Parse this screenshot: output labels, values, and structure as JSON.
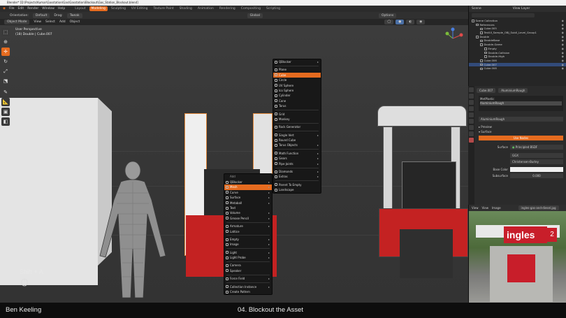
{
  "window": {
    "title": "Blender* [D:\\Projects\\Kumar\\Gasstation\\Gas\\Gasstation\\Blockout\\Gas_Station_Blockout.blend]"
  },
  "menubar": {
    "items": [
      "File",
      "Edit",
      "Render",
      "Window",
      "Help"
    ],
    "workspaces": [
      "Layout",
      "Modeling",
      "Sculpting",
      "UV Editing",
      "Texture Paint",
      "Shading",
      "Animation",
      "Rendering",
      "Compositing",
      "Scripting"
    ],
    "active_workspace": "Modeling",
    "scene_label": "Scene",
    "viewlayer_label": "View Layer"
  },
  "tool_options": {
    "orientation_label": "Orientation:",
    "orientation_value": "Default",
    "drag_label": "Drag:",
    "drag_value": "Tweak",
    "transform_orientation": "Global",
    "options_label": "Options"
  },
  "header": {
    "mode": "Object Mode",
    "items": [
      "View",
      "Select",
      "Add",
      "Object"
    ]
  },
  "viewport": {
    "perspective": "User Perspective",
    "object_info": "(18) Double | Cube.007",
    "shortcut_overlay": "Shift + A"
  },
  "toolbar": {
    "tools": [
      "select-icon",
      "cursor-icon",
      "move-icon",
      "rotate-icon",
      "scale-icon",
      "transform-icon",
      "annotate-icon",
      "measure-icon",
      "add-cube-icon",
      "extrude-icon"
    ]
  },
  "add_menu": {
    "title": "Add",
    "items": [
      {
        "label": "QBlocker",
        "submenu": true
      },
      {
        "label": "Mesh",
        "submenu": true,
        "highlight": true
      },
      {
        "label": "Curve",
        "submenu": true
      },
      {
        "label": "Surface",
        "submenu": true
      },
      {
        "label": "Metaball",
        "submenu": true
      },
      {
        "label": "Text",
        "submenu": false
      },
      {
        "label": "Volume",
        "submenu": true
      },
      {
        "label": "Grease Pencil",
        "submenu": true
      },
      {
        "label": "Armature",
        "submenu": true
      },
      {
        "label": "Lattice",
        "submenu": false
      },
      {
        "label": "Empty",
        "submenu": true
      },
      {
        "label": "Image",
        "submenu": true
      },
      {
        "label": "Light",
        "submenu": true
      },
      {
        "label": "Light Probe",
        "submenu": true
      },
      {
        "label": "Camera",
        "submenu": false
      },
      {
        "label": "Speaker",
        "submenu": false
      },
      {
        "label": "Force Field",
        "submenu": true
      },
      {
        "label": "Collection Instance",
        "submenu": true
      },
      {
        "label": "Create Pattern",
        "submenu": false
      }
    ]
  },
  "mesh_menu": {
    "items": [
      {
        "label": "QBlocker",
        "submenu": true
      },
      {
        "label": "Plane"
      },
      {
        "label": "Cube",
        "highlight": true
      },
      {
        "label": "Circle"
      },
      {
        "label": "UV Sphere"
      },
      {
        "label": "Ico Sphere"
      },
      {
        "label": "Cylinder"
      },
      {
        "label": "Cone"
      },
      {
        "label": "Torus"
      },
      {
        "label": "Grid"
      },
      {
        "label": "Monkey"
      },
      {
        "label": "Rock Generator"
      },
      {
        "label": "Single Vert",
        "submenu": true
      },
      {
        "label": "Round Cube"
      },
      {
        "label": "Torus Objects",
        "submenu": true
      },
      {
        "label": "Math Function",
        "submenu": true
      },
      {
        "label": "Gears",
        "submenu": true
      },
      {
        "label": "Pipe Joints",
        "submenu": true
      },
      {
        "label": "Diamonds",
        "submenu": true
      },
      {
        "label": "Extras",
        "submenu": true
      },
      {
        "label": "Parent To Empty"
      },
      {
        "label": "Landscape"
      }
    ]
  },
  "outliner": {
    "title": "Scene Collection",
    "rows": [
      {
        "label": "Scene Collection",
        "indent": 0,
        "selected": false
      },
      {
        "label": "References",
        "indent": 1,
        "selected": false
      },
      {
        "label": "Cube.005",
        "indent": 2,
        "selected": false
      },
      {
        "label": "TestUI_Sample_OBJ_Sub0_Level_Group1",
        "indent": 2,
        "selected": false
      },
      {
        "label": "Double",
        "indent": 1,
        "selected": false
      },
      {
        "label": "DoubleBase",
        "indent": 2,
        "selected": false
      },
      {
        "label": "Double-Game",
        "indent": 2,
        "selected": false
      },
      {
        "label": "Empty",
        "indent": 3,
        "selected": false
      },
      {
        "label": "Double-Collision",
        "indent": 3,
        "selected": false
      },
      {
        "label": "Double-High",
        "indent": 3,
        "selected": false
      },
      {
        "label": "Cube.006",
        "indent": 2,
        "selected": false
      },
      {
        "label": "Cube.007",
        "indent": 2,
        "selected": true
      },
      {
        "label": "Cube.008",
        "indent": 2,
        "selected": false
      }
    ]
  },
  "properties": {
    "object_name": "Cube.007",
    "material_name": "AluminiumRough",
    "slots": [
      "MetPlastic",
      "AluminiumRough"
    ],
    "material_field": "AluminiumRough",
    "sections": [
      "Preview",
      "Surface"
    ],
    "use_nodes_label": "Use Nodes",
    "surface_label": "Surface",
    "surface_value": "Principled BSDF",
    "distribution": "GGX",
    "subsurface_method": "Christensen-Burley",
    "base_color_label": "Base Color",
    "subsurface_label": "Subsurface",
    "subsurface_value": "0.000"
  },
  "image_editor": {
    "items": [
      "View",
      "View",
      "Image"
    ],
    "image_name": "ingles-gas-and-diesel.jpg",
    "sign_text": "ingles",
    "sign_number": "2"
  },
  "caption": {
    "author": "Ben Keeling",
    "lesson": "04. Blockout the Asset"
  },
  "colors": {
    "accent": "#e56b1f",
    "selection": "#324b7a",
    "pump_red": "#c42222"
  }
}
